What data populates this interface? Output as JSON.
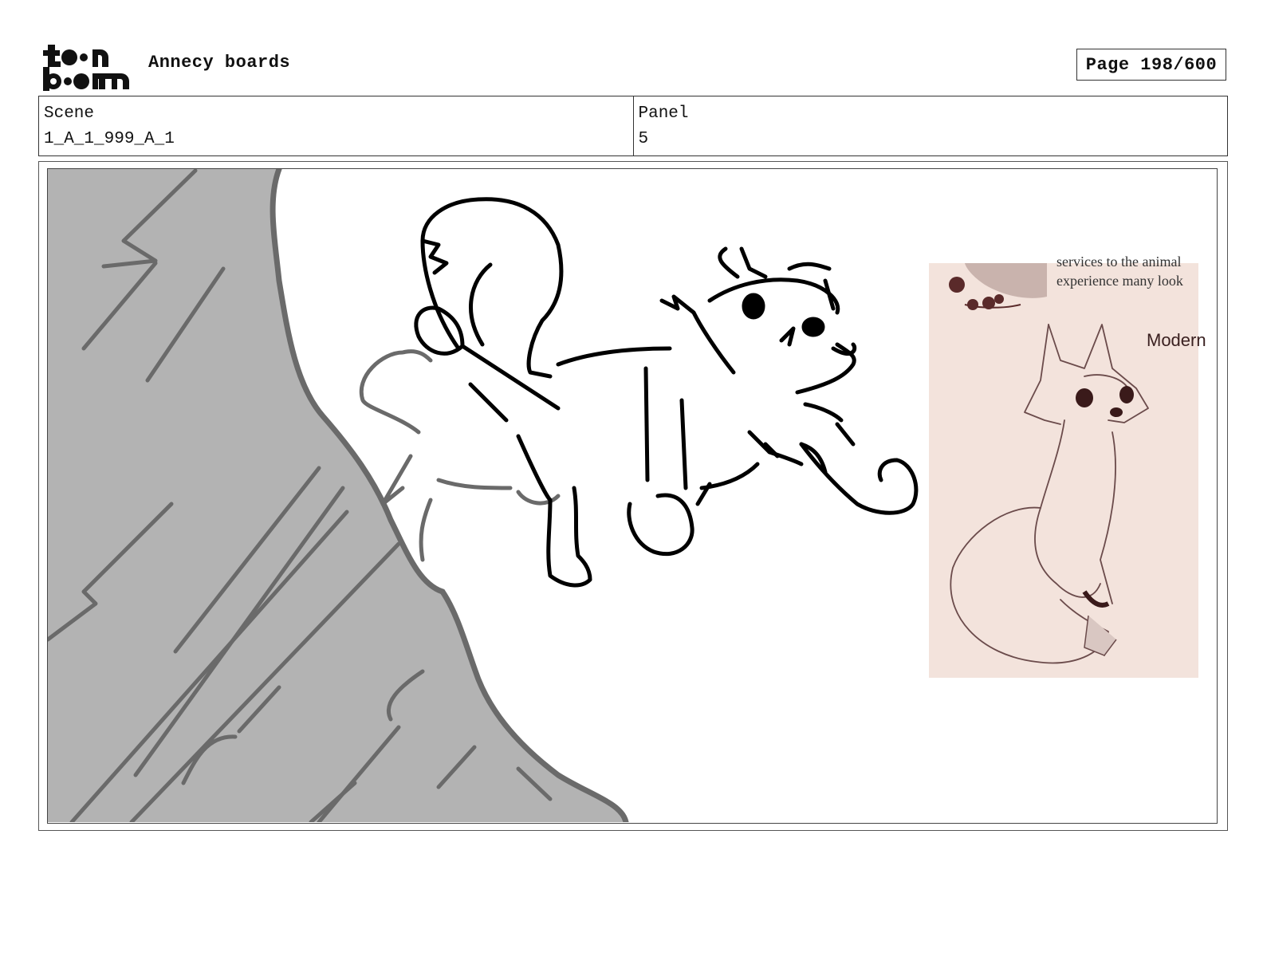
{
  "header": {
    "logo_line1": "toon",
    "logo_line2": "boom",
    "title": "Annecy boards",
    "page": "Page 198/600"
  },
  "info": {
    "scene_label": "Scene",
    "scene_value": "1_A_1_999_A_1",
    "panel_label": "Panel",
    "panel_value": "5"
  },
  "reference": {
    "text_line1": "services to the animal",
    "text_line2": "experience many look",
    "heading": "Modern"
  },
  "colors": {
    "cliff_fill": "#b3b3b3",
    "cliff_lines": "#6a6a6a",
    "sketch_stroke": "#000000",
    "reference_bg": "#f3e3dc"
  }
}
